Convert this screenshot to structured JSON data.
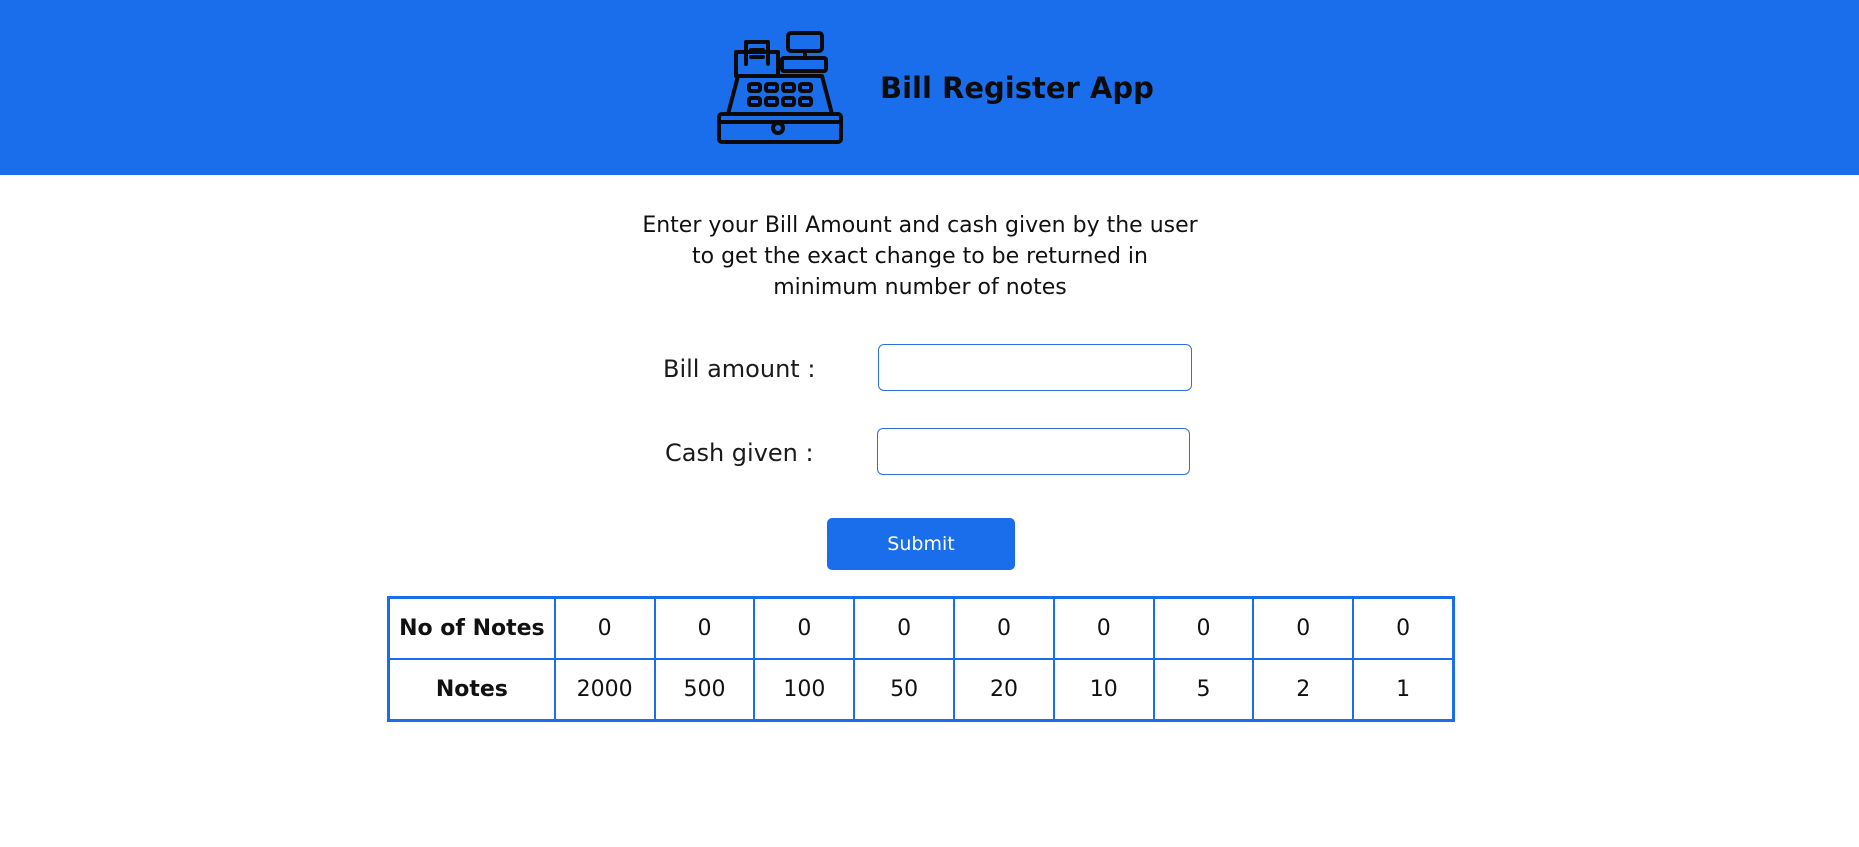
{
  "header": {
    "title": "Bill Register App",
    "logo_icon": "cash-register-icon",
    "background_color": "#1b6eeb"
  },
  "instructions": "Enter your Bill Amount and cash given by the user to get the exact change to be returned in minimum number of notes",
  "form": {
    "bill_amount_label": "Bill amount :",
    "bill_amount_value": "",
    "cash_given_label": "Cash given :",
    "cash_given_value": "",
    "submit_label": "Submit"
  },
  "table": {
    "count_row_label": "No of Notes",
    "notes_row_label": "Notes",
    "counts": [
      "0",
      "0",
      "0",
      "0",
      "0",
      "0",
      "0",
      "0",
      "0"
    ],
    "notes": [
      "2000",
      "500",
      "100",
      "50",
      "20",
      "10",
      "5",
      "2",
      "1"
    ]
  }
}
